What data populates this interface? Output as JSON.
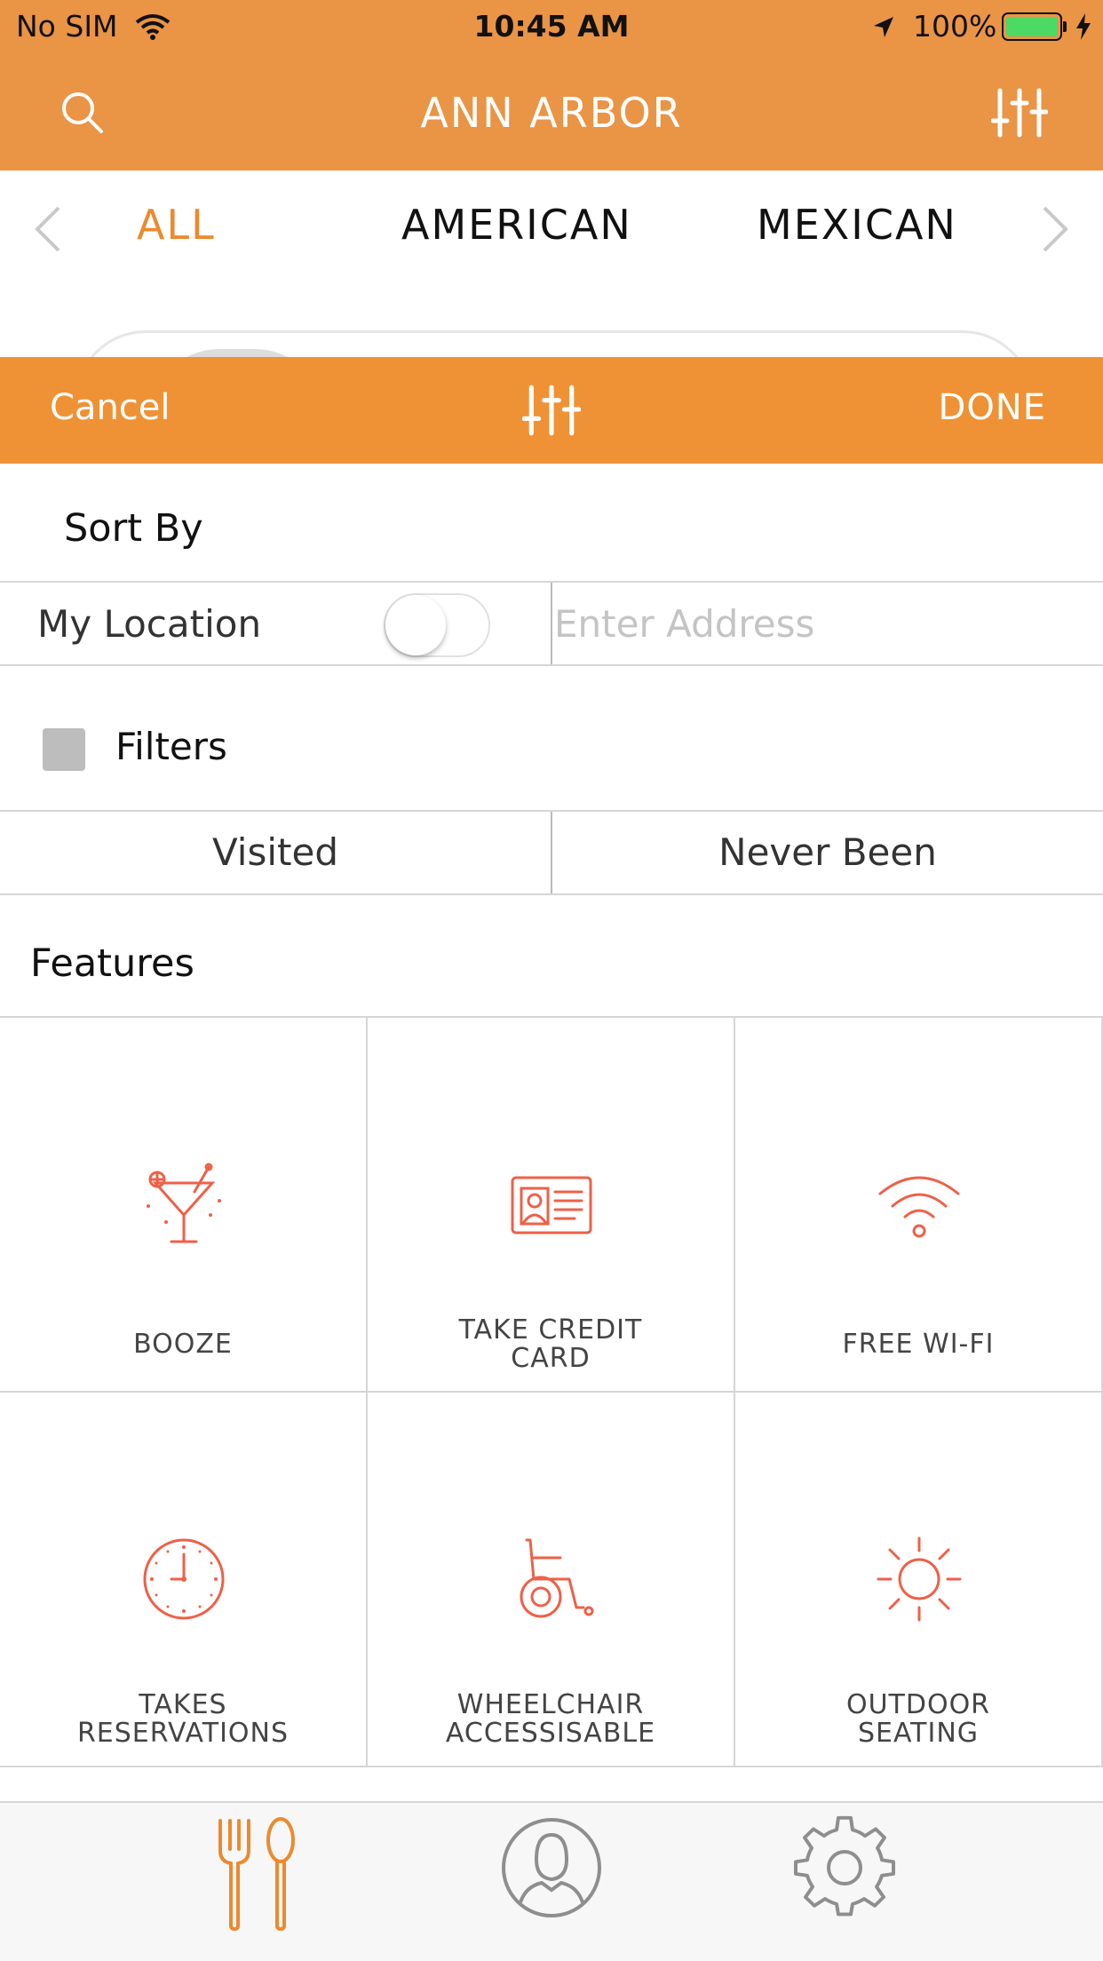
{
  "status_bar": {
    "carrier": "No SIM",
    "time": "10:45 AM",
    "battery": "100%"
  },
  "nav": {
    "title": "ANN ARBOR"
  },
  "categories": {
    "tabs": [
      {
        "label": "ALL",
        "selected": true
      },
      {
        "label": "AMERICAN",
        "selected": false
      },
      {
        "label": "MEXICAN",
        "selected": false
      }
    ]
  },
  "sheet": {
    "cancel_label": "Cancel",
    "done_label": "DONE",
    "sort_by_label": "Sort By",
    "my_location_label": "My Location",
    "my_location_enabled": false,
    "address_placeholder": "Enter Address",
    "address_value": "",
    "filters_label": "Filters",
    "filters_checked": false,
    "visit_segments": [
      {
        "label": "Visited"
      },
      {
        "label": "Never Been"
      }
    ],
    "features_title": "Features",
    "features": [
      {
        "label_lines": [
          "BOOZE"
        ],
        "icon": "cocktail-icon"
      },
      {
        "label_lines": [
          "TAKE CREDIT",
          "CARD"
        ],
        "icon": "credit-card-icon"
      },
      {
        "label_lines": [
          "FREE WI-FI"
        ],
        "icon": "wifi-icon"
      },
      {
        "label_lines": [
          "TAKES",
          "RESERVATIONS"
        ],
        "icon": "clock-icon"
      },
      {
        "label_lines": [
          "WHEELCHAIR",
          "ACCESSISABLE"
        ],
        "icon": "wheelchair-icon"
      },
      {
        "label_lines": [
          "OUTDOOR",
          "SEATING"
        ],
        "icon": "sun-icon"
      }
    ]
  },
  "colors": {
    "nav_orange": "#EA9446",
    "sheet_orange": "#EF9235",
    "selected_tab": "#EB8A2F",
    "feature_icon": "#EE6048",
    "battery_green": "#4CD964"
  },
  "tab_bar": {
    "items": [
      {
        "icon": "fork-spoon-icon",
        "selected": true
      },
      {
        "icon": "profile-icon",
        "selected": false
      },
      {
        "icon": "gear-icon",
        "selected": false
      }
    ]
  }
}
